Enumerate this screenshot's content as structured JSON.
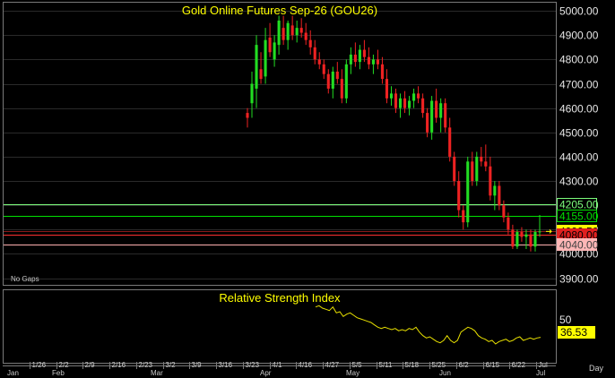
{
  "chart_data": {
    "type": "candlestick",
    "title": "Gold Online Futures Sep-26 (GOU26)",
    "note": "No Gaps",
    "timeframe_label": "Day",
    "y_axis": {
      "min": 3880,
      "max": 5030,
      "ticks": [
        3900,
        4000,
        4100,
        4200,
        4300,
        4400,
        4500,
        4600,
        4700,
        4800,
        4900,
        5000
      ],
      "tick_labels": [
        "3900.00",
        "4000.00",
        "4100.00",
        "4200.00",
        "4300.00",
        "4400.00",
        "4500.00",
        "4600.00",
        "4700.00",
        "4800.00",
        "4900.00",
        "5000.00"
      ]
    },
    "x_axis": {
      "week_ticks": [
        "1/26",
        "2/2",
        "2/9",
        "2/16",
        "2/23",
        "3/2",
        "3/9",
        "3/16",
        "3/23",
        "4/1",
        "4/16",
        "4/27",
        "5/5",
        "5/11",
        "5/18",
        "5/25",
        "6/2",
        "6/15",
        "6/22",
        "Jul"
      ],
      "month_labels": [
        "Jan",
        "Feb",
        "Mar",
        "Apr",
        "May",
        "Jun",
        "Jul"
      ]
    },
    "levels": [
      {
        "value": 4205,
        "label": "4205.00",
        "line_color": "#7cfc7c",
        "box_bg": "#000000",
        "box_border": "#7cfc7c",
        "text_color": "#7cfc7c"
      },
      {
        "value": 4155,
        "label": "4155.00",
        "line_color": "#00e000",
        "box_bg": "#000000",
        "box_border": "#00e000",
        "text_color": "#00e000"
      },
      {
        "value": 4092.5,
        "label": "4092.50",
        "line_color": "#8a1a1a",
        "box_bg": "#ffff00",
        "box_border": "#ffff00",
        "text_color": "#000000"
      },
      {
        "value": 4080,
        "label": "4080.00",
        "line_color": "#ff3030",
        "box_bg": "#e02020",
        "box_border": "#e02020",
        "text_color": "#000000"
      },
      {
        "value": 4040,
        "label": "4040.00",
        "line_color": "#ffb0b0",
        "box_bg": "#ffb6b6",
        "box_border": "#ffb6b6",
        "text_color": "#404040"
      }
    ],
    "candles": [
      {
        "o": 4580,
        "h": 4600,
        "l": 4520,
        "c": 4560
      },
      {
        "o": 4620,
        "h": 4750,
        "l": 4560,
        "c": 4700
      },
      {
        "o": 4680,
        "h": 4900,
        "l": 4600,
        "c": 4860
      },
      {
        "o": 4760,
        "h": 4830,
        "l": 4700,
        "c": 4720
      },
      {
        "o": 4730,
        "h": 4930,
        "l": 4700,
        "c": 4880
      },
      {
        "o": 4890,
        "h": 4950,
        "l": 4810,
        "c": 4830
      },
      {
        "o": 4800,
        "h": 4900,
        "l": 4770,
        "c": 4870
      },
      {
        "o": 4860,
        "h": 4980,
        "l": 4820,
        "c": 4960
      },
      {
        "o": 4930,
        "h": 4980,
        "l": 4860,
        "c": 4880
      },
      {
        "o": 4880,
        "h": 4960,
        "l": 4840,
        "c": 4950
      },
      {
        "o": 4940,
        "h": 4980,
        "l": 4880,
        "c": 4900
      },
      {
        "o": 4900,
        "h": 4960,
        "l": 4870,
        "c": 4930
      },
      {
        "o": 4930,
        "h": 4970,
        "l": 4890,
        "c": 4910
      },
      {
        "o": 4910,
        "h": 4950,
        "l": 4860,
        "c": 4880
      },
      {
        "o": 4880,
        "h": 4920,
        "l": 4820,
        "c": 4850
      },
      {
        "o": 4850,
        "h": 4880,
        "l": 4780,
        "c": 4800
      },
      {
        "o": 4800,
        "h": 4830,
        "l": 4760,
        "c": 4780
      },
      {
        "o": 4780,
        "h": 4800,
        "l": 4720,
        "c": 4740
      },
      {
        "o": 4740,
        "h": 4760,
        "l": 4660,
        "c": 4680
      },
      {
        "o": 4680,
        "h": 4770,
        "l": 4640,
        "c": 4750
      },
      {
        "o": 4750,
        "h": 4790,
        "l": 4700,
        "c": 4720
      },
      {
        "o": 4720,
        "h": 4760,
        "l": 4620,
        "c": 4640
      },
      {
        "o": 4640,
        "h": 4800,
        "l": 4620,
        "c": 4780
      },
      {
        "o": 4780,
        "h": 4850,
        "l": 4740,
        "c": 4820
      },
      {
        "o": 4820,
        "h": 4870,
        "l": 4770,
        "c": 4790
      },
      {
        "o": 4790,
        "h": 4860,
        "l": 4760,
        "c": 4840
      },
      {
        "o": 4840,
        "h": 4880,
        "l": 4790,
        "c": 4810
      },
      {
        "o": 4810,
        "h": 4850,
        "l": 4760,
        "c": 4780
      },
      {
        "o": 4780,
        "h": 4820,
        "l": 4740,
        "c": 4800
      },
      {
        "o": 4800,
        "h": 4840,
        "l": 4760,
        "c": 4780
      },
      {
        "o": 4780,
        "h": 4810,
        "l": 4700,
        "c": 4720
      },
      {
        "o": 4720,
        "h": 4760,
        "l": 4620,
        "c": 4640
      },
      {
        "o": 4640,
        "h": 4690,
        "l": 4610,
        "c": 4660
      },
      {
        "o": 4660,
        "h": 4680,
        "l": 4580,
        "c": 4600
      },
      {
        "o": 4600,
        "h": 4660,
        "l": 4560,
        "c": 4640
      },
      {
        "o": 4640,
        "h": 4670,
        "l": 4580,
        "c": 4600
      },
      {
        "o": 4600,
        "h": 4650,
        "l": 4570,
        "c": 4630
      },
      {
        "o": 4630,
        "h": 4680,
        "l": 4600,
        "c": 4660
      },
      {
        "o": 4660,
        "h": 4690,
        "l": 4620,
        "c": 4640
      },
      {
        "o": 4640,
        "h": 4660,
        "l": 4560,
        "c": 4580
      },
      {
        "o": 4580,
        "h": 4600,
        "l": 4480,
        "c": 4500
      },
      {
        "o": 4500,
        "h": 4650,
        "l": 4470,
        "c": 4630
      },
      {
        "o": 4630,
        "h": 4680,
        "l": 4540,
        "c": 4560
      },
      {
        "o": 4560,
        "h": 4640,
        "l": 4500,
        "c": 4620
      },
      {
        "o": 4620,
        "h": 4640,
        "l": 4500,
        "c": 4520
      },
      {
        "o": 4520,
        "h": 4560,
        "l": 4380,
        "c": 4400
      },
      {
        "o": 4400,
        "h": 4420,
        "l": 4280,
        "c": 4300
      },
      {
        "o": 4300,
        "h": 4340,
        "l": 4150,
        "c": 4180
      },
      {
        "o": 4180,
        "h": 4200,
        "l": 4100,
        "c": 4130
      },
      {
        "o": 4130,
        "h": 4400,
        "l": 4110,
        "c": 4380
      },
      {
        "o": 4380,
        "h": 4420,
        "l": 4280,
        "c": 4300
      },
      {
        "o": 4300,
        "h": 4420,
        "l": 4280,
        "c": 4400
      },
      {
        "o": 4400,
        "h": 4440,
        "l": 4360,
        "c": 4380
      },
      {
        "o": 4380,
        "h": 4450,
        "l": 4340,
        "c": 4360
      },
      {
        "o": 4360,
        "h": 4400,
        "l": 4220,
        "c": 4240
      },
      {
        "o": 4240,
        "h": 4300,
        "l": 4180,
        "c": 4280
      },
      {
        "o": 4280,
        "h": 4300,
        "l": 4180,
        "c": 4200
      },
      {
        "o": 4200,
        "h": 4220,
        "l": 4130,
        "c": 4150
      },
      {
        "o": 4150,
        "h": 4170,
        "l": 4080,
        "c": 4100
      },
      {
        "o": 4100,
        "h": 4120,
        "l": 4020,
        "c": 4030
      },
      {
        "o": 4030,
        "h": 4100,
        "l": 4020,
        "c": 4090
      },
      {
        "o": 4090,
        "h": 4110,
        "l": 4050,
        "c": 4070
      },
      {
        "o": 4070,
        "h": 4100,
        "l": 4020,
        "c": 4080
      },
      {
        "o": 4080,
        "h": 4100,
        "l": 4010,
        "c": 4030
      },
      {
        "o": 4030,
        "h": 4100,
        "l": 4010,
        "c": 4090
      },
      {
        "o": 4090,
        "h": 4160,
        "l": 4070,
        "c": 4092.5
      }
    ],
    "rsi": {
      "title": "Relative Strength Index",
      "level": 50,
      "level_label": "50",
      "current_label": "36.53",
      "values": [
        62,
        63,
        61,
        60,
        59,
        62,
        57,
        58,
        54,
        56,
        57,
        55,
        53,
        52,
        51,
        50,
        49,
        47,
        45,
        44,
        45,
        44,
        43,
        44,
        42,
        43,
        42,
        44,
        43,
        45,
        41,
        38,
        36,
        37,
        35,
        33,
        32,
        34,
        38,
        34,
        32,
        34,
        41,
        43,
        45,
        44,
        42,
        38,
        36,
        35,
        33,
        34,
        31,
        33,
        34,
        35,
        33,
        34,
        36,
        37,
        34,
        35,
        36,
        35,
        36,
        36.53
      ]
    }
  }
}
